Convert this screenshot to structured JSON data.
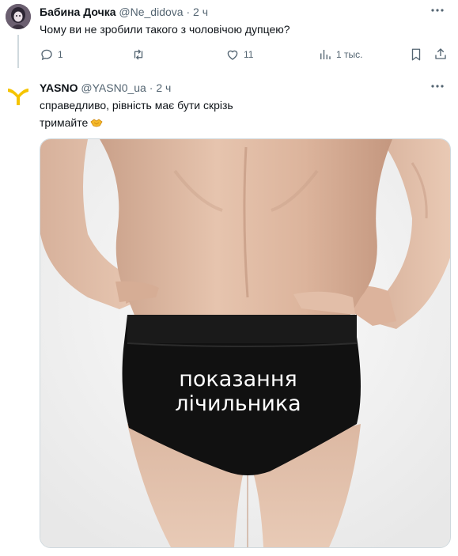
{
  "tweet1": {
    "author_name": "Бабина Дочка",
    "handle": "@Ne_didova",
    "separator": "·",
    "time": "2 ч",
    "text": "Чому ви не зробили такого з чоловічою дупцею?",
    "actions": {
      "reply_count": "1",
      "retweet_count": "",
      "like_count": "11",
      "views_count": "1 тыс."
    }
  },
  "tweet2": {
    "author_name": "YASNO",
    "handle": "@YASN0_ua",
    "separator": "·",
    "time": "2 ч",
    "text_line1": "справедливо, рівність має бути скрізь",
    "text_line2": "тримайте",
    "emoji": "handshake",
    "image": {
      "caption_line1": "показання",
      "caption_line2": "лічильника"
    }
  },
  "colors": {
    "text": "#0f1419",
    "muted": "#536471",
    "brand_yellow": "#f5c400",
    "border": "#cfd9de"
  },
  "icons": [
    "reply-icon",
    "retweet-icon",
    "like-icon",
    "views-icon",
    "bookmark-icon",
    "share-icon",
    "more-icon",
    "handshake-emoji"
  ]
}
